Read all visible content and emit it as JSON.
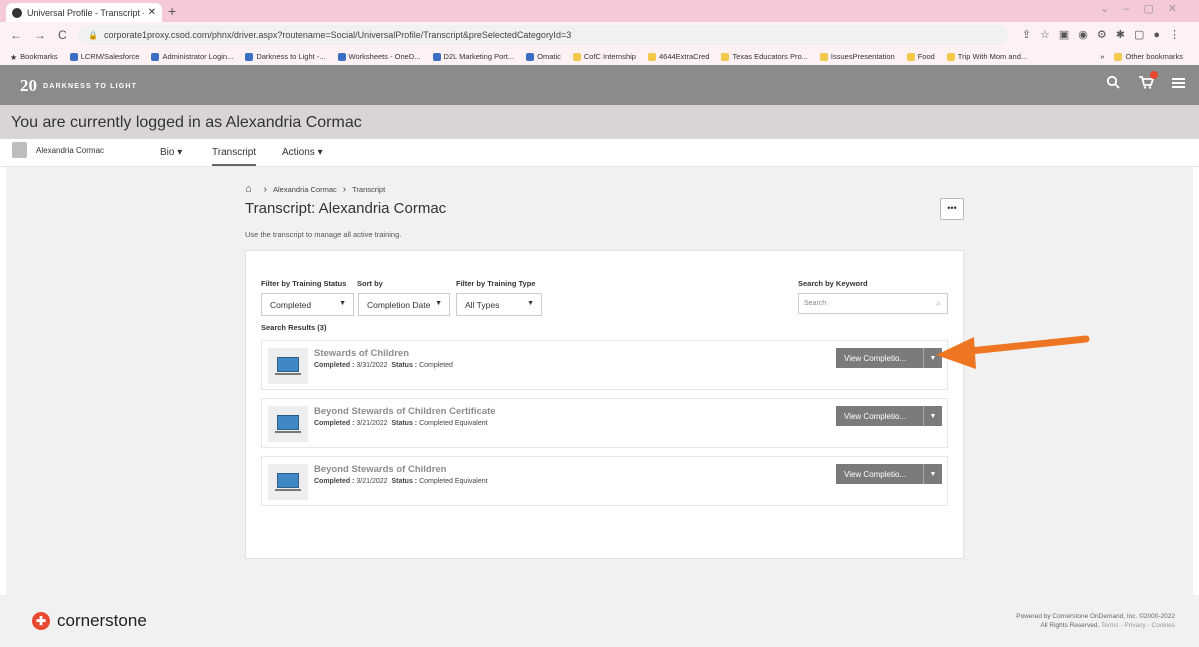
{
  "browser": {
    "tab_title": "Universal Profile - Transcript - Re",
    "tab_close": "✕",
    "new_tab": "+",
    "url": "corporate1proxy.csod.com/phnx/driver.aspx?routename=Social/UniversalProfile/Transcript&preSelectedCategoryId=3",
    "bookmarks": [
      "Bookmarks",
      "LCRM/Salesforce",
      "Administrator Login...",
      "Darkness to Light -...",
      "Worksheets - OneD...",
      "D2L Marketing Port...",
      "Omatic",
      "CofC Internship",
      "4644ExtraCred",
      "Texas Educators Pro...",
      "IssuesPresentation",
      "Food",
      "Trip With Mom and..."
    ],
    "other_bookmarks": "Other bookmarks",
    "more_bookmarks": "»"
  },
  "app": {
    "logo_number": "20",
    "logo_text": "DARKNESS TO LIGHT"
  },
  "banner": {
    "logged_in_text": "You are currently logged in as Alexandria Cormac"
  },
  "profile_nav": {
    "name": "Alexandria Cormac",
    "bio": "Bio ▾",
    "transcript": "Transcript",
    "actions": "Actions ▾"
  },
  "breadcrumb": {
    "user": "Alexandria Cormac",
    "current": "Transcript"
  },
  "page": {
    "title": "Transcript: Alexandria Cormac",
    "description": "Use the transcript to manage all active training.",
    "more": "•••"
  },
  "filters": {
    "status_label": "Filter by Training Status",
    "sort_label": "Sort by",
    "type_label": "Filter by Training Type",
    "keyword_label": "Search by Keyword",
    "status_value": "Completed",
    "sort_value": "Completion Date",
    "type_value": "All Types",
    "search_placeholder": "Search"
  },
  "results": {
    "count_text": "Search Results (3)",
    "items": [
      {
        "title": "Stewards of Children",
        "completed_label": "Completed :",
        "completed": "3/31/2022",
        "status_label": "Status :",
        "status": "Completed",
        "button": "View Completio..."
      },
      {
        "title": "Beyond Stewards of Children Certificate",
        "completed_label": "Completed :",
        "completed": "3/21/2022",
        "status_label": "Status :",
        "status": "Completed Equivalent",
        "button": "View Completio..."
      },
      {
        "title": "Beyond Stewards of Children",
        "completed_label": "Completed :",
        "completed": "3/21/2022",
        "status_label": "Status :",
        "status": "Completed Equivalent",
        "button": "View Completio..."
      }
    ]
  },
  "footer": {
    "brand": "cornerstone",
    "powered_line1": "Powered by Cornerstone OnDemand, Inc. ©2000-2022",
    "powered_line2": "All Rights Reserved.",
    "links": "Terms - Privacy - Cookies"
  },
  "colors": {
    "header_bg": "#8b8b8b",
    "accent_arrow": "#ee7623",
    "button_bg": "#7b7b7b",
    "brand_red": "#e8492e"
  }
}
